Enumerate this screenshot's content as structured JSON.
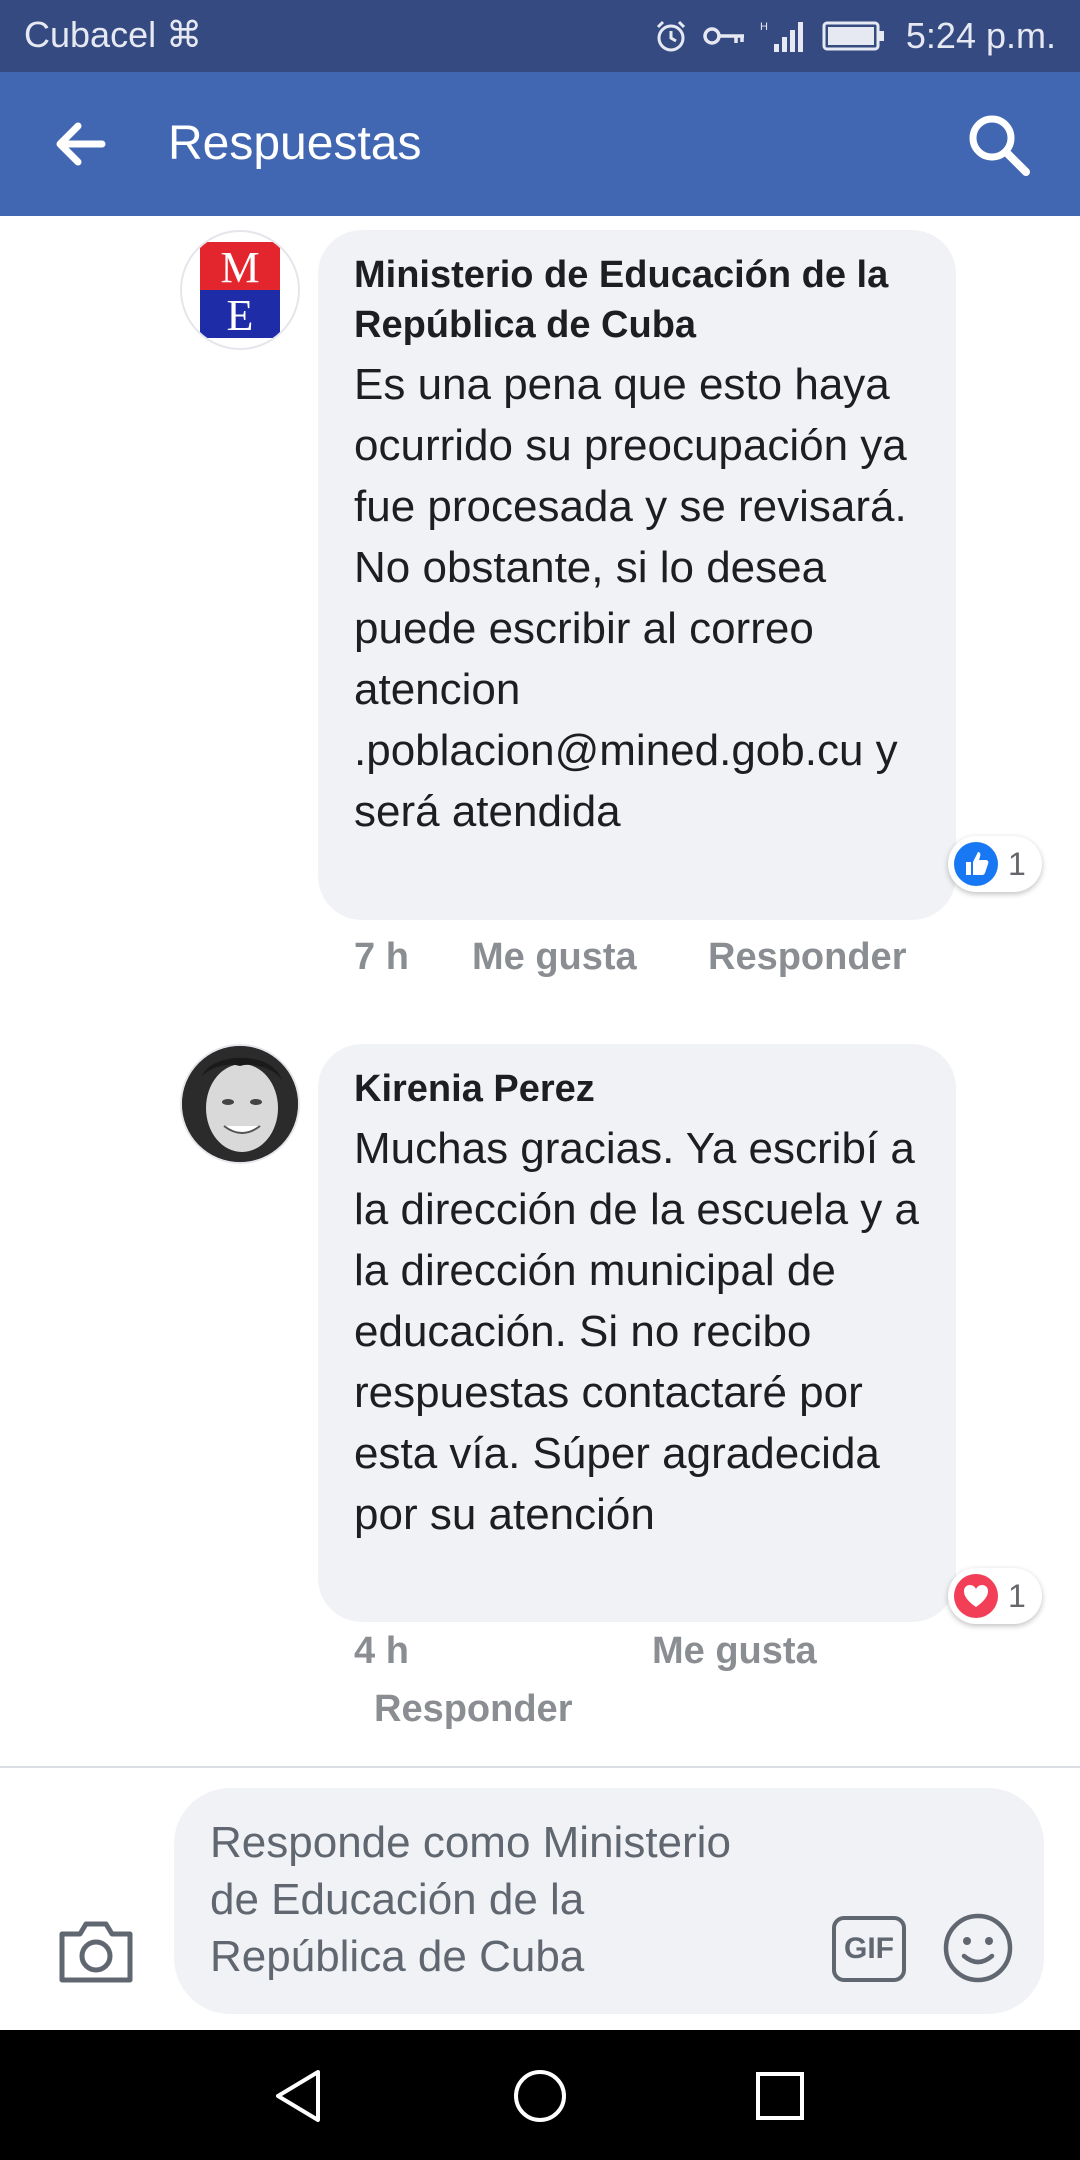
{
  "status_bar": {
    "carrier": "Cubacel",
    "time": "5:24 p.m."
  },
  "app_bar": {
    "title": "Respuestas"
  },
  "comments": [
    {
      "author": "Ministerio de Educación de la República de Cuba",
      "text": "Es una pena que esto haya ocurrido su preocupación ya fue procesada y se revisará. No obstante, si lo desea puede escribir al correo atencion .poblacion@mined.gob.cu y será atendida",
      "avatar_letters": [
        "M",
        "E"
      ],
      "reaction_icon": "like-icon",
      "reaction_count": "1",
      "time": "7 h",
      "like_label": "Me gusta",
      "reply_label": "Responder"
    },
    {
      "author": "Kirenia Perez",
      "text": "Muchas gracias. Ya escribí a la dirección de la escuela y a la dirección municipal de educación. Si no recibo respuestas contactaré por esta vía. Súper agradecida por su atención",
      "reaction_icon": "love-icon",
      "reaction_count": "1",
      "time": "4 h",
      "like_label": "Me gusta",
      "reply_label": "Responder"
    }
  ],
  "composer": {
    "placeholder": "Responde como Ministerio de Educación de la República de Cuba",
    "gif_label": "GIF"
  },
  "colors": {
    "status_bar": "#364a82",
    "app_bar": "#4267b2",
    "bubble": "#f0f2f5",
    "like_blue": "#1877f2",
    "love_red": "#f33e58"
  }
}
